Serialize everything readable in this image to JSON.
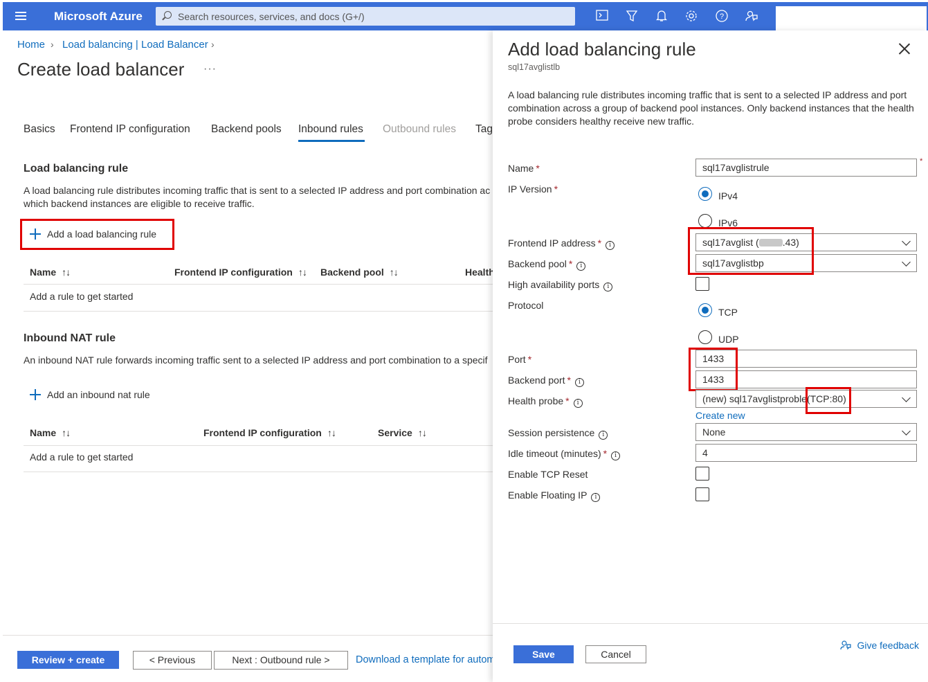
{
  "topbar": {
    "brand": "Microsoft Azure",
    "search_placeholder": "Search resources, services, and docs (G+/)"
  },
  "breadcrumb": {
    "home": "Home",
    "parent": "Load balancing | Load Balancer"
  },
  "page_title": "Create load balancer",
  "more": "···",
  "tabs": [
    {
      "label": "Basics",
      "state": "normal"
    },
    {
      "label": "Frontend IP configuration",
      "state": "normal"
    },
    {
      "label": "Backend pools",
      "state": "normal"
    },
    {
      "label": "Inbound rules",
      "state": "active"
    },
    {
      "label": "Outbound rules",
      "state": "disabled"
    },
    {
      "label": "Tag",
      "state": "normal"
    }
  ],
  "lb_rule_section": {
    "title": "Load balancing rule",
    "desc1": "A load balancing rule distributes incoming traffic that is sent to a selected IP address and port combination ac",
    "desc2": "which backend instances are eligible to receive traffic.",
    "add_label": "Add a load balancing rule",
    "columns": [
      "Name",
      "Frontend IP configuration",
      "Backend pool",
      "Health"
    ],
    "sort_glyph": "↑↓",
    "empty": "Add a rule to get started"
  },
  "nat_section": {
    "title": "Inbound NAT rule",
    "desc": "An inbound NAT rule forwards incoming traffic sent to a selected IP address and port combination to a specif",
    "add_label": "Add an inbound nat rule",
    "columns": [
      "Name",
      "Frontend IP configuration",
      "Service"
    ],
    "empty": "Add a rule to get started"
  },
  "footer": {
    "review": "Review + create",
    "previous": "< Previous",
    "next": "Next : Outbound rule >",
    "download": "Download a template for autom"
  },
  "panel": {
    "title": "Add load balancing rule",
    "subtitle": "sql17avglistlb",
    "description": "A load balancing rule distributes incoming traffic that is sent to a selected IP address and port combination across a group of backend pool instances. Only backend instances that the health probe considers healthy receive new traffic.",
    "labels": {
      "name": "Name",
      "ip_version": "IP Version",
      "frontend_ip": "Frontend IP address",
      "backend_pool": "Backend pool",
      "ha_ports": "High availability ports",
      "protocol": "Protocol",
      "port": "Port",
      "backend_port": "Backend port",
      "health_probe": "Health probe",
      "session_persistence": "Session persistence",
      "idle_timeout": "Idle timeout (minutes)",
      "tcp_reset": "Enable TCP Reset",
      "floating_ip": "Enable Floating IP"
    },
    "values": {
      "name": "sql17avglistrule",
      "ipv4": "IPv4",
      "ipv6": "IPv6",
      "frontend_ip_prefix": "sql17avglist (",
      "frontend_ip_suffix": ".43)",
      "backend_pool": "sql17avglistbp",
      "tcp": "TCP",
      "udp": "UDP",
      "port": "1433",
      "backend_port": "1433",
      "health_probe": "(new) sql17avglistproble",
      "health_probe_suffix": "(TCP:80)",
      "create_new": "Create new",
      "session_persistence": "None",
      "idle_timeout": "4"
    },
    "required_mark": "*",
    "save": "Save",
    "cancel": "Cancel",
    "feedback": "Give feedback"
  },
  "colors": {
    "azure_blue": "#3a6fd8",
    "link": "#0f6cbd",
    "highlight": "#e00000"
  }
}
